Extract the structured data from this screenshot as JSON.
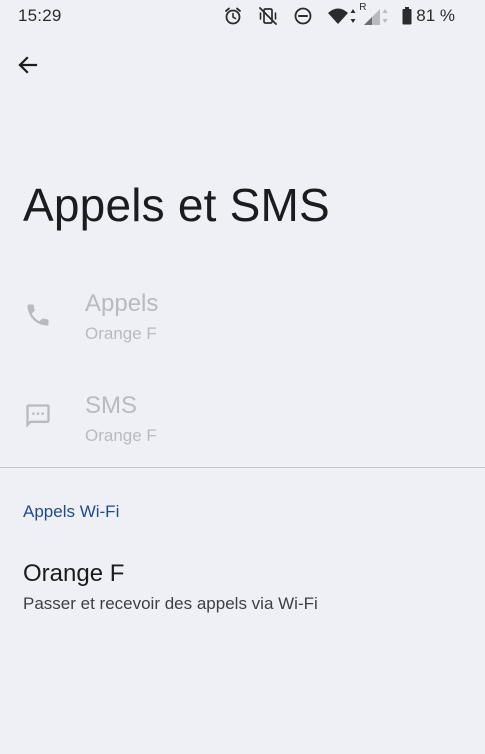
{
  "status_bar": {
    "time": "15:29",
    "icons": [
      "alarm-icon",
      "vibrate-off-icon",
      "do-not-disturb-icon",
      "wifi-icon",
      "signal-roaming-icon",
      "battery-icon"
    ],
    "roaming_label": "R",
    "battery": "81 %"
  },
  "toolbar": {
    "back_icon": "arrow-left-icon"
  },
  "page": {
    "title": "Appels et SMS"
  },
  "preferences": [
    {
      "icon": "phone-icon",
      "title": "Appels",
      "summary": "Orange F",
      "enabled": false
    },
    {
      "icon": "message-icon",
      "title": "SMS",
      "summary": "Orange F",
      "enabled": false
    }
  ],
  "wifi_calling": {
    "category": "Appels Wi-Fi",
    "title": "Orange F",
    "summary": "Passer et recevoir des appels via Wi-Fi"
  },
  "colors": {
    "background": "#eff0f5",
    "category_accent": "#1f4c89",
    "disabled_text": "#b9bac0"
  }
}
